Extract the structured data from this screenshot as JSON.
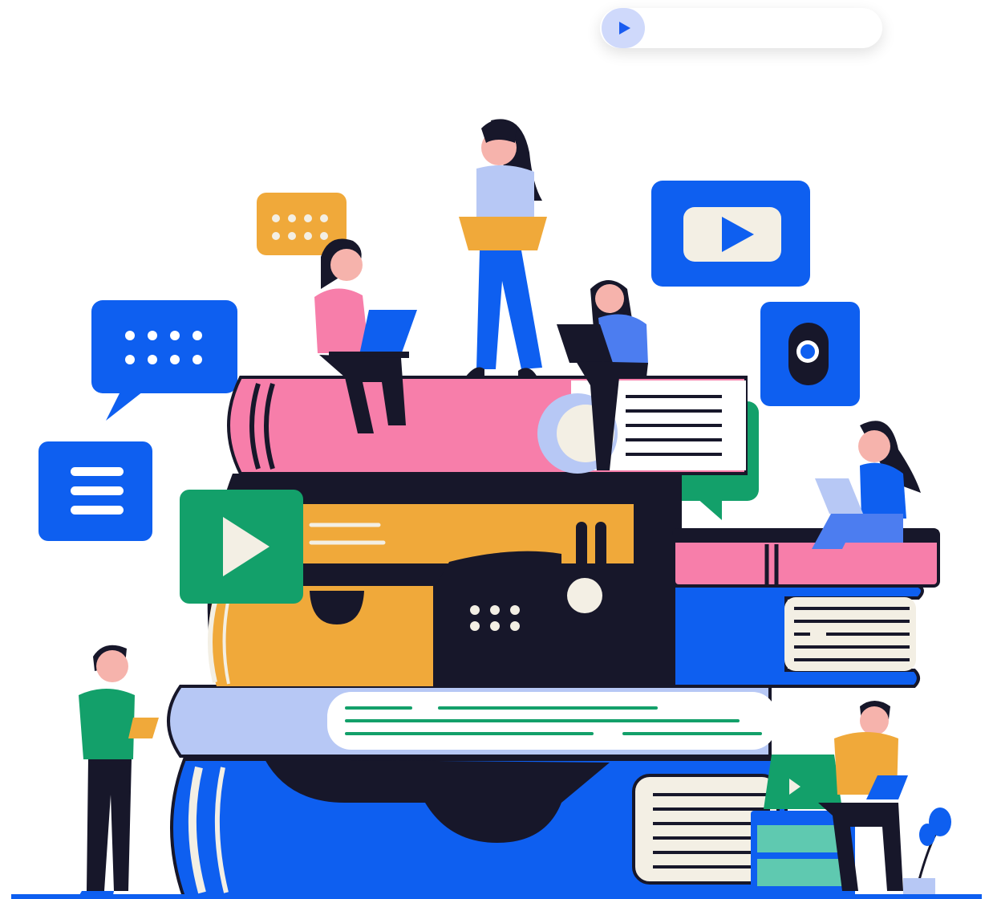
{
  "audio_player": {
    "play_icon": "play-icon",
    "accent": "#1a5cf0",
    "button_bg": "#cfd9fb"
  },
  "illustration": {
    "subject": "people-studying-on-stack-of-books",
    "colors": {
      "blue": "#0e5ff0",
      "pink": "#f77eaa",
      "yellow": "#f0a93a",
      "green": "#13a06a",
      "navy": "#17172a",
      "light_blue": "#b7c8f5",
      "cream": "#f3efe4",
      "teal": "#5fc9b0"
    }
  }
}
